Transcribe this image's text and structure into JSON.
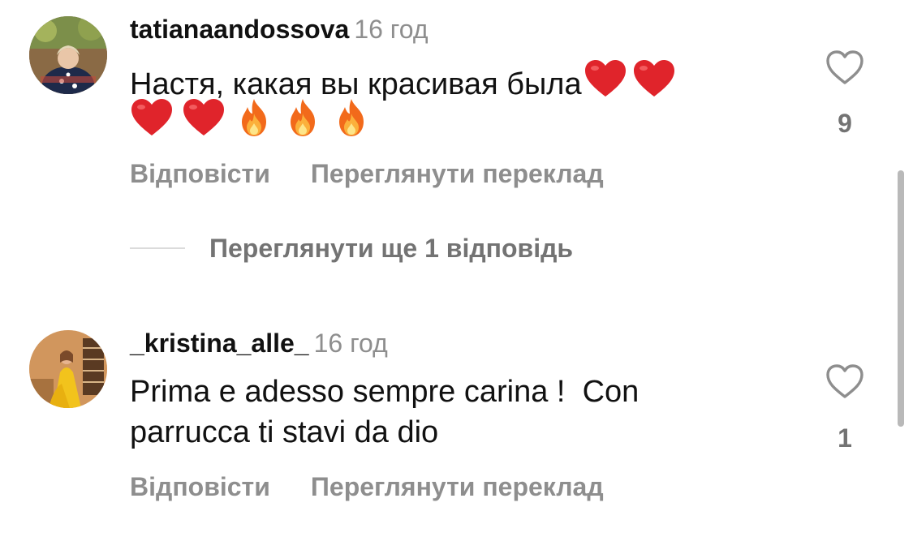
{
  "comments": [
    {
      "username": "tatianaandossova",
      "time": "16 год",
      "text_line1": "Настя, какая вы красивая была",
      "emoji_inline": [
        "red-heart",
        "red-heart"
      ],
      "emoji_row": [
        "red-heart",
        "red-heart",
        "fire",
        "fire",
        "fire"
      ],
      "reply_label": "Відповісти",
      "translate_label": "Переглянути переклад",
      "likes": "9",
      "like_icon": "heart-outline-icon"
    },
    {
      "username": "_kristina_alle_",
      "time": "16 год",
      "text_line1": "Prima e adesso sempre carina !  Con",
      "text_line2": "parrucca ti stavi da dio",
      "reply_label": "Відповісти",
      "translate_label": "Переглянути переклад",
      "likes": "1",
      "like_icon": "heart-outline-icon"
    }
  ],
  "view_replies": "Переглянути ще 1 відповідь",
  "colors": {
    "text": "#111111",
    "secondary": "#8e8e8e",
    "heart_emoji": "#e0242b",
    "fire_emoji": "#f7941d",
    "divider": "#dbdbdb",
    "scrollbar": "#b9b9b9"
  }
}
